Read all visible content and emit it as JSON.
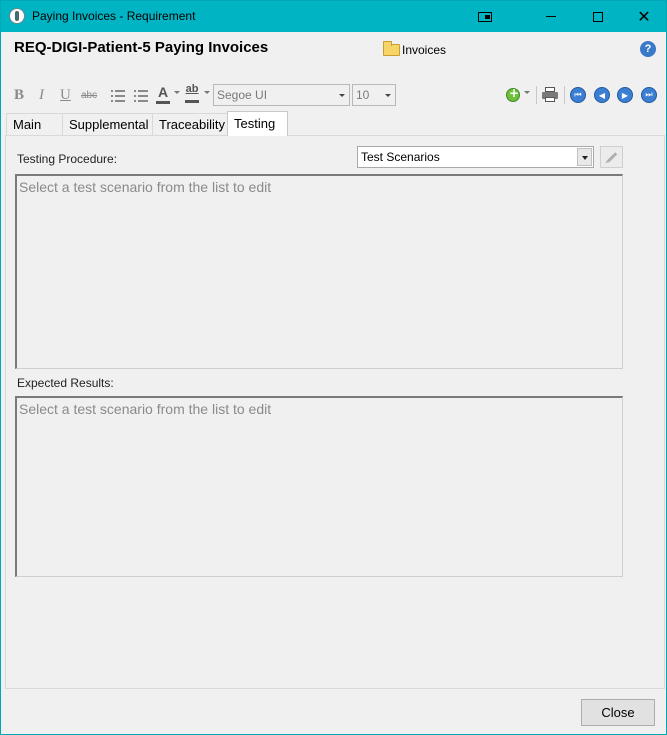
{
  "window": {
    "title": "Paying Invoices - Requirement",
    "accent_color": "#00b4c4",
    "controls": {
      "minimize_icon": "minimize-icon",
      "maximize_icon": "maximize-icon",
      "close_icon": "close-icon",
      "close_glyph": "✕"
    }
  },
  "header": {
    "requirement_title": "REQ-DIGI-Patient-5 Paying Invoices",
    "folder_label": "Invoices",
    "help_glyph": "?"
  },
  "toolbar": {
    "bold": "B",
    "italic": "I",
    "underline": "U",
    "strikethrough": "abc",
    "font_color": "A",
    "highlight": "ab",
    "font_name": "Segoe UI",
    "font_size": "10",
    "nav_first": "⏮",
    "nav_prev": "◀",
    "nav_next": "▶",
    "nav_last": "⏭"
  },
  "tabs": [
    {
      "label": "Main",
      "active": false
    },
    {
      "label": "Supplemental",
      "active": false
    },
    {
      "label": "Traceability",
      "active": false
    },
    {
      "label": "Testing",
      "active": true
    }
  ],
  "testing": {
    "procedure_label": "Testing Procedure:",
    "scenario_select_value": "Test Scenarios",
    "procedure_placeholder": "Select a test scenario from the list to edit",
    "expected_label": "Expected Results:",
    "expected_placeholder": "Select a test scenario from the list to edit"
  },
  "footer": {
    "close_label": "Close"
  }
}
